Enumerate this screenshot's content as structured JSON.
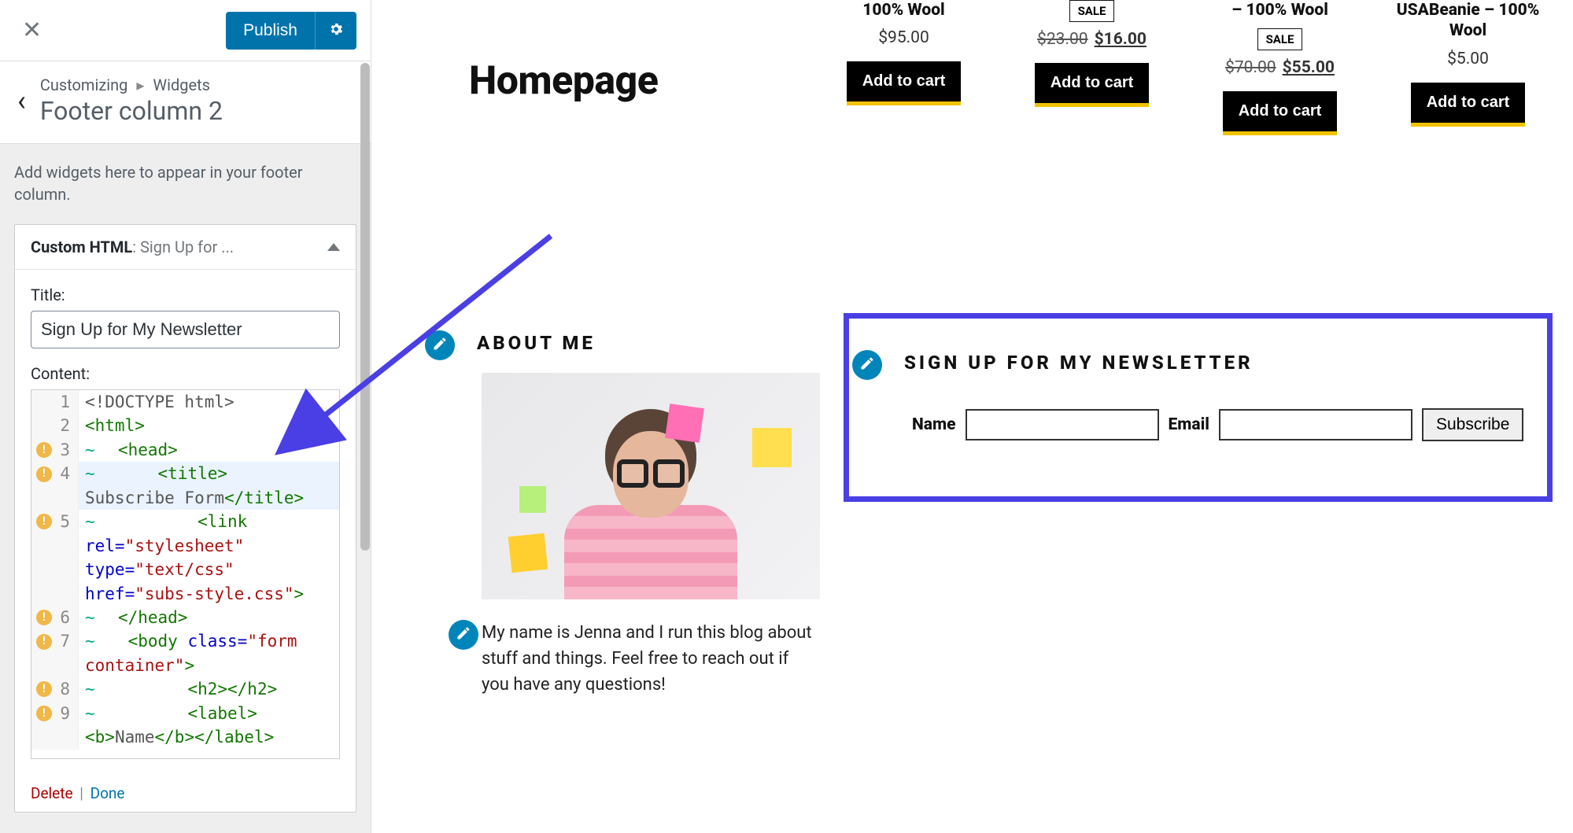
{
  "sidebar": {
    "publish_label": "Publish",
    "breadcrumb_root": "Customizing",
    "breadcrumb_leaf": "Widgets",
    "section_title": "Footer column 2",
    "help_text": "Add widgets here to appear in your footer column.",
    "widget": {
      "type_label": "Custom HTML",
      "name_truncated": "Sign Up for ...",
      "title_field_label": "Title:",
      "title_value": "Sign Up for My Newsletter",
      "content_field_label": "Content:",
      "delete_label": "Delete",
      "done_label": "Done",
      "code_lines": [
        {
          "n": 1,
          "warn": false,
          "wrap": false,
          "tokens": [
            {
              "c": "t-plain",
              "t": "<!DOCTYPE html>"
            }
          ]
        },
        {
          "n": 2,
          "warn": false,
          "wrap": false,
          "tokens": [
            {
              "c": "t-tag",
              "t": "<html>"
            }
          ]
        },
        {
          "n": 3,
          "warn": true,
          "wrap": true,
          "tokens": [
            {
              "c": "t-tag",
              "t": "  <head>"
            }
          ]
        },
        {
          "n": 4,
          "warn": true,
          "wrap": true,
          "hl": true,
          "tokens": [
            {
              "c": "t-tag",
              "t": "      <title>"
            }
          ],
          "cont": [
            {
              "c": "t-plain",
              "t": "Subscribe Form"
            },
            {
              "c": "t-tag",
              "t": "</title>"
            }
          ]
        },
        {
          "n": 5,
          "warn": true,
          "wrap": true,
          "tokens": [
            {
              "c": "t-tag",
              "t": "          <link"
            }
          ],
          "cont_multi": [
            [
              {
                "c": "t-attr",
                "t": "rel="
              },
              {
                "c": "t-str",
                "t": "\"stylesheet\""
              }
            ],
            [
              {
                "c": "t-attr",
                "t": "type="
              },
              {
                "c": "t-str",
                "t": "\"text/css\""
              }
            ],
            [
              {
                "c": "t-attr",
                "t": "href="
              },
              {
                "c": "t-str",
                "t": "\"subs-style.css\""
              },
              {
                "c": "t-tag",
                "t": ">"
              }
            ]
          ]
        },
        {
          "n": 6,
          "warn": true,
          "wrap": true,
          "tokens": [
            {
              "c": "t-tag",
              "t": "  </head>"
            }
          ]
        },
        {
          "n": 7,
          "warn": true,
          "wrap": true,
          "tokens": [
            {
              "c": "t-tag",
              "t": "   <body "
            },
            {
              "c": "t-attr",
              "t": "class="
            },
            {
              "c": "t-str",
              "t": "\"form"
            }
          ],
          "cont": [
            {
              "c": "t-str",
              "t": "container\""
            },
            {
              "c": "t-tag",
              "t": ">"
            }
          ]
        },
        {
          "n": 8,
          "warn": true,
          "wrap": true,
          "tokens": [
            {
              "c": "t-tag",
              "t": "         <h2></h2>"
            }
          ]
        },
        {
          "n": 9,
          "warn": true,
          "wrap": true,
          "tokens": [
            {
              "c": "t-tag",
              "t": "         <label>"
            }
          ],
          "cont": [
            {
              "c": "t-tag",
              "t": "<b>"
            },
            {
              "c": "t-plain",
              "t": "Name"
            },
            {
              "c": "t-tag",
              "t": "</b></label>"
            }
          ]
        }
      ]
    }
  },
  "preview": {
    "page_title": "Homepage",
    "products": [
      {
        "title": "100% Wool",
        "sale": false,
        "price": "$95.00",
        "old": "",
        "new": "",
        "cta": "Add to cart"
      },
      {
        "title": "",
        "sale": true,
        "sale_label": "SALE",
        "price": "",
        "old": "$23.00",
        "new": "$16.00",
        "cta": "Add to cart"
      },
      {
        "title": "– 100% Wool",
        "sale": true,
        "sale_label": "SALE",
        "price": "",
        "old": "$70.00",
        "new": "$55.00",
        "cta": "Add to cart"
      },
      {
        "title": "USABeanie – 100% Wool",
        "sale": false,
        "price": "$5.00",
        "old": "",
        "new": "",
        "cta": "Add to cart"
      }
    ],
    "about": {
      "heading": "ABOUT ME",
      "text": "My name is Jenna and I run this blog about stuff and things. Feel free to reach out if you have any questions!"
    },
    "newsletter": {
      "heading": "SIGN UP FOR MY NEWSLETTER",
      "name_label": "Name",
      "email_label": "Email",
      "button_label": "Subscribe"
    }
  }
}
